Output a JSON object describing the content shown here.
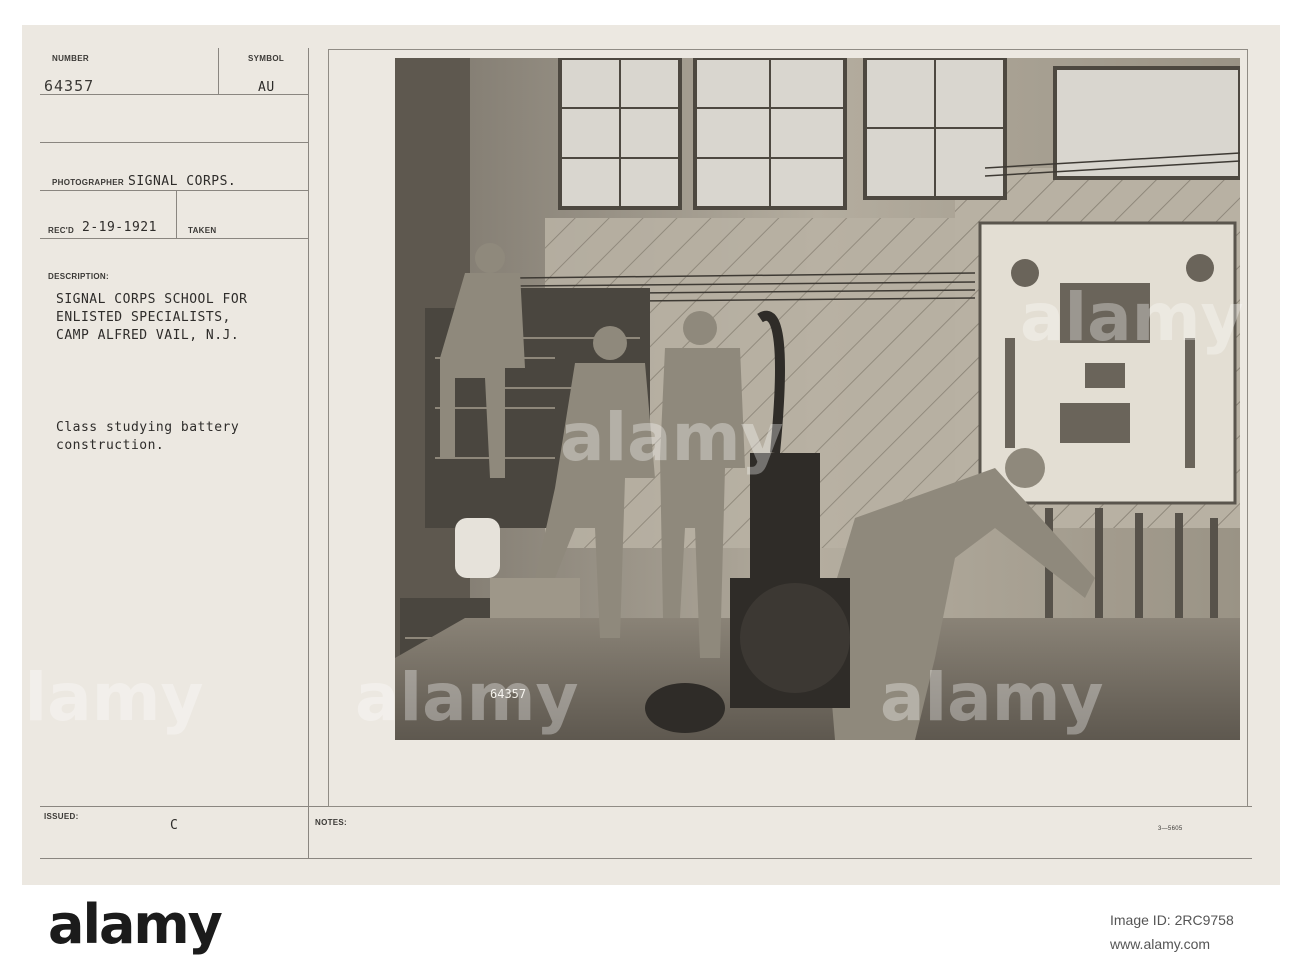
{
  "card": {
    "number_label": "NUMBER",
    "number_value": "64357",
    "symbol_label": "SYMBOL",
    "symbol_value": "AU",
    "photographer_label": "PHOTOGRAPHER",
    "photographer_value": "SIGNAL CORPS.",
    "recd_label": "REC'D",
    "recd_value": "2-19-1921",
    "taken_label": "TAKEN",
    "description_label": "DESCRIPTION:",
    "description_lines": [
      "SIGNAL CORPS SCHOOL FOR",
      "ENLISTED SPECIALISTS,",
      "CAMP ALFRED VAIL, N.J."
    ],
    "caption_lines": [
      "Class studying battery",
      "construction."
    ],
    "issued_label": "ISSUED:",
    "issued_value": "C",
    "notes_label": "NOTES:",
    "form_number": "3—5605"
  },
  "photo": {
    "negative_number": "64357",
    "description": "Black-and-white photograph of soldiers working with battery racks, a switchboard panel and a generator in a wooden workshop"
  },
  "watermark": {
    "text": "alamy"
  },
  "footer": {
    "logo_text": "alamy",
    "image_id_label": "Image ID:",
    "image_id_value": "2RC9758",
    "site": "www.alamy.com"
  },
  "colors": {
    "card": "#ece8e1",
    "photo_tone": "#6f6a61",
    "ink": "#2e2c2a"
  }
}
